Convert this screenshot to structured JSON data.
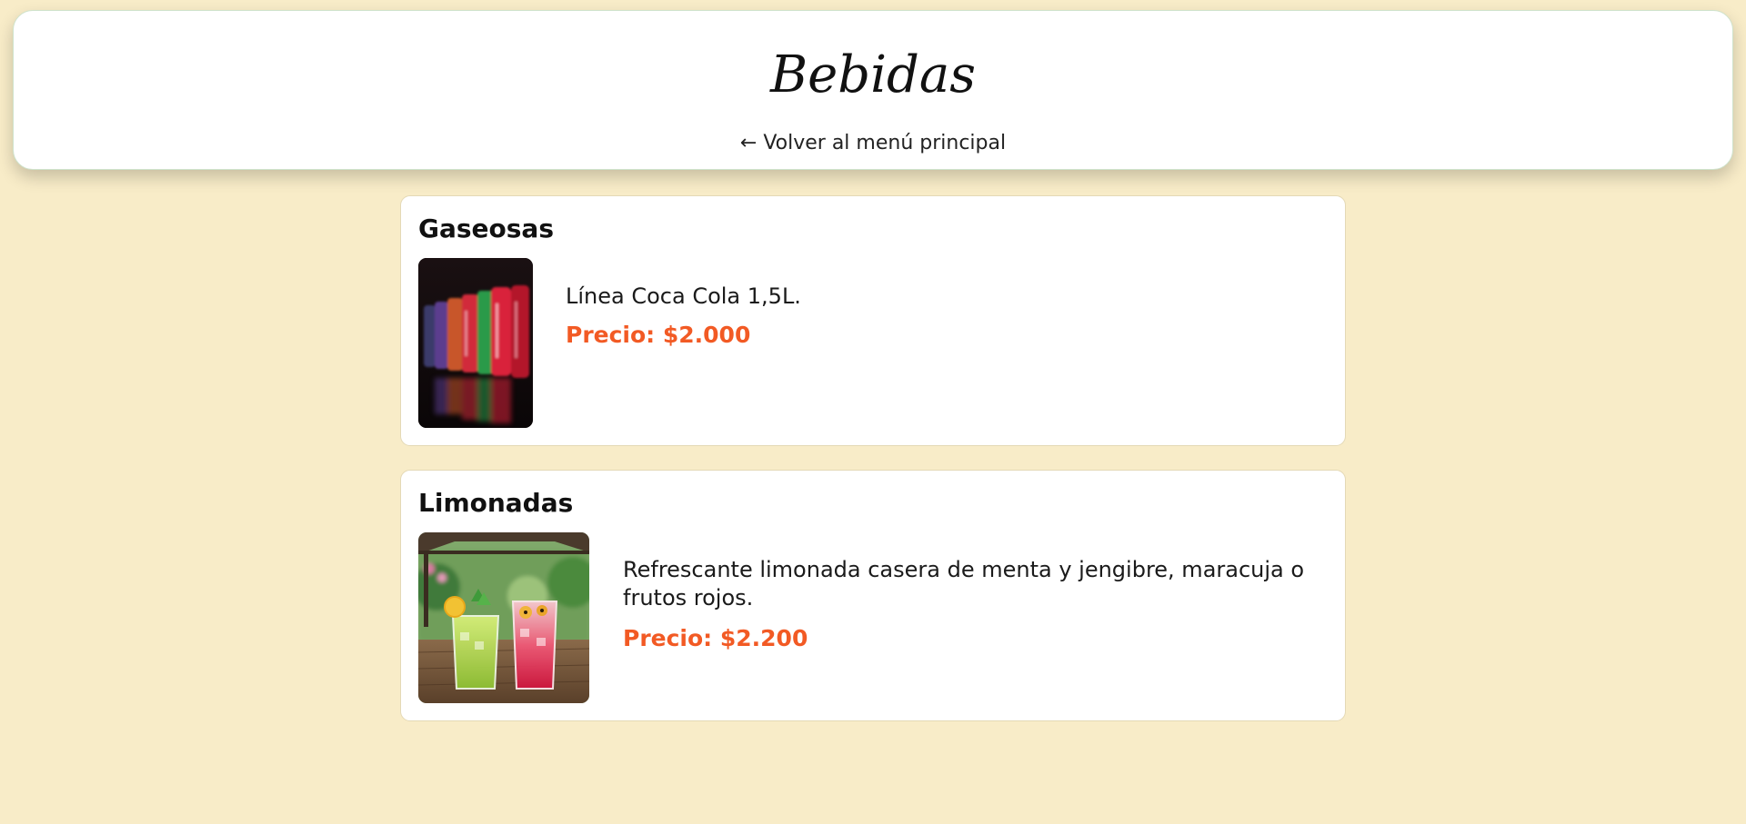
{
  "header": {
    "title": "Bebidas",
    "back_link": "← Volver al menú principal"
  },
  "colors": {
    "background": "#f8ecc8",
    "price": "#f25a24",
    "card": "#ffffff"
  },
  "sections": [
    {
      "title": "Gaseosas",
      "image_icon": "soda-cans-image",
      "description": "Línea Coca Cola 1,5L.",
      "price": "Precio: $2.000"
    },
    {
      "title": "Limonadas",
      "image_icon": "lemonade-glasses-image",
      "description": "Refrescante limonada casera de menta y jengibre, maracuja o frutos rojos.",
      "price": "Precio: $2.200"
    }
  ]
}
